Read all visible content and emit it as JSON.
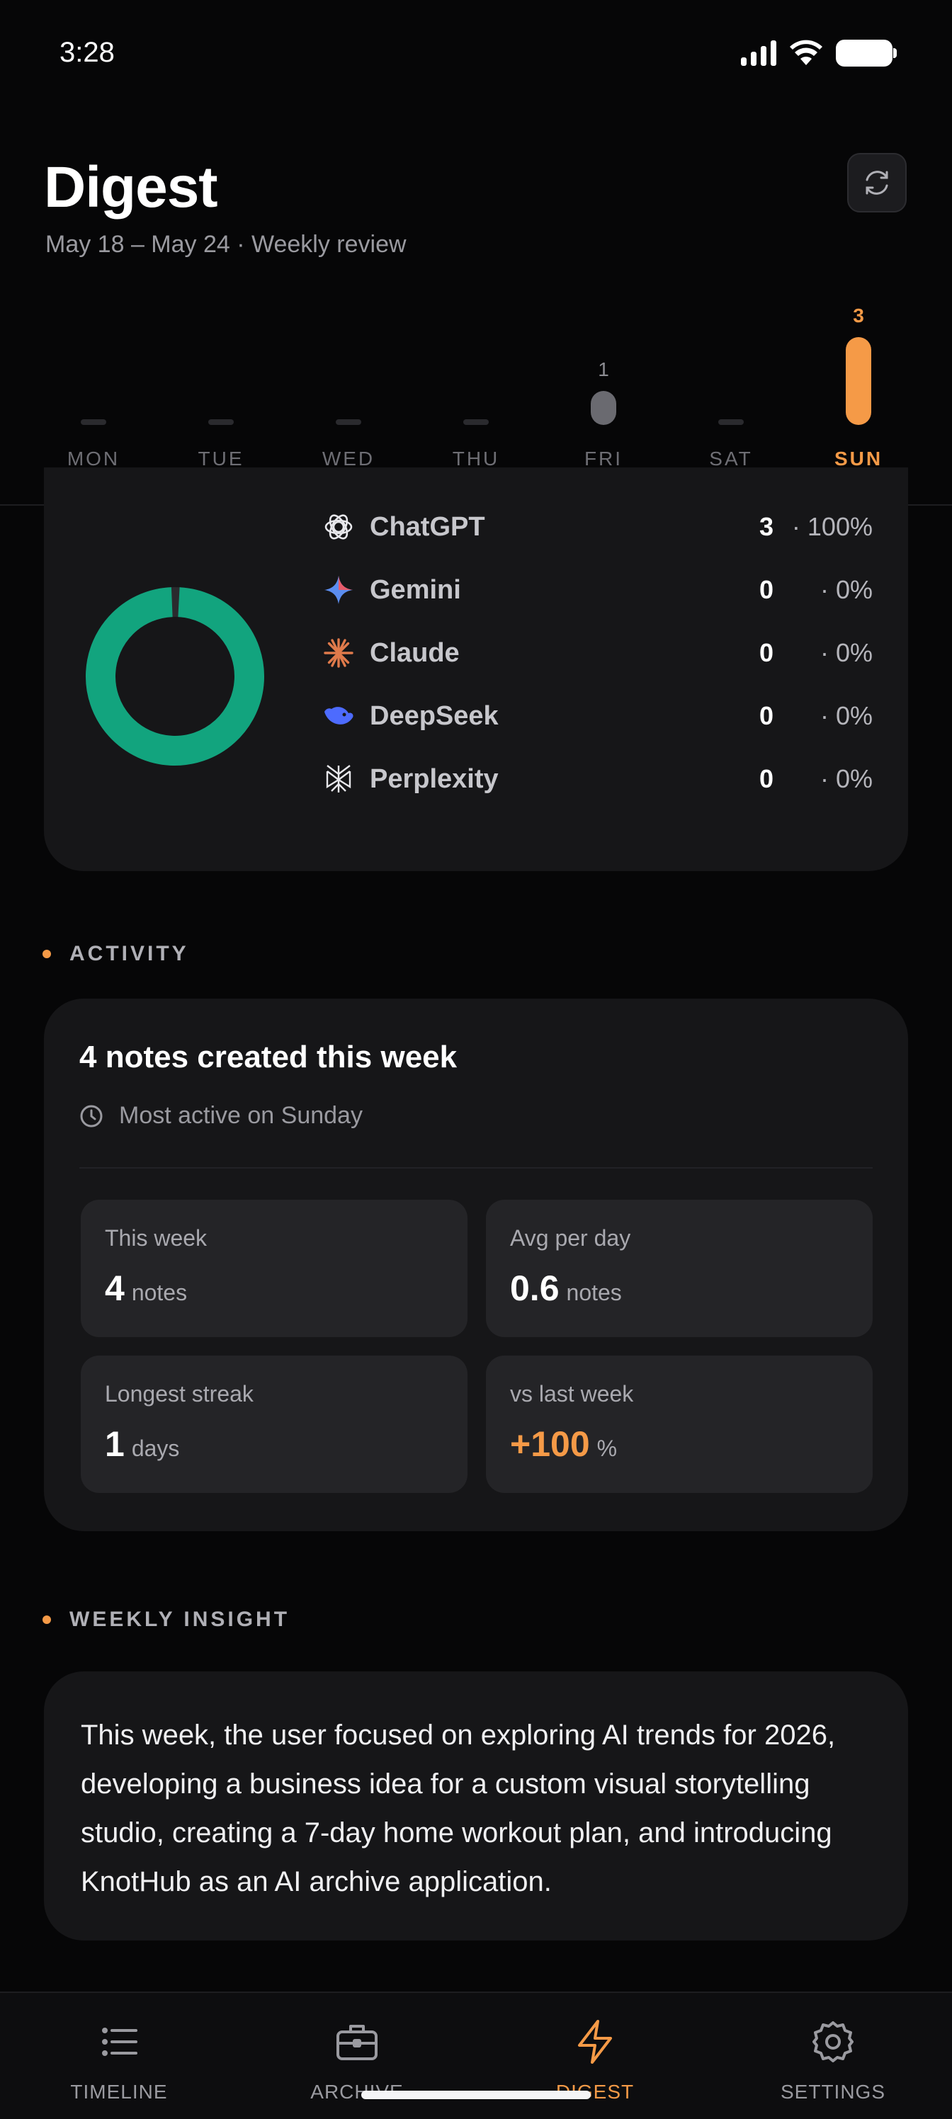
{
  "status_bar": {
    "time": "3:28"
  },
  "header": {
    "title": "Digest",
    "subtitle": "May 18 – May 24 · Weekly review",
    "refresh_icon": "refresh-icon"
  },
  "week_activity": {
    "days": [
      {
        "label": "MON",
        "count": 0,
        "count_label": ""
      },
      {
        "label": "TUE",
        "count": 0,
        "count_label": ""
      },
      {
        "label": "WED",
        "count": 0,
        "count_label": ""
      },
      {
        "label": "THU",
        "count": 0,
        "count_label": ""
      },
      {
        "label": "FRI",
        "count": 1,
        "count_label": "1"
      },
      {
        "label": "SAT",
        "count": 0,
        "count_label": ""
      },
      {
        "label": "SUN",
        "count": 3,
        "count_label": "3"
      }
    ],
    "active_day": "SUN",
    "accent_color": "#f59a47"
  },
  "models": {
    "donut_color": "#12a47e",
    "items": [
      {
        "name": "ChatGPT",
        "count": "3",
        "pct": "· 100%",
        "icon": "chatgpt-icon"
      },
      {
        "name": "Gemini",
        "count": "0",
        "pct": "· 0%",
        "icon": "gemini-icon"
      },
      {
        "name": "Claude",
        "count": "0",
        "pct": "· 0%",
        "icon": "claude-icon"
      },
      {
        "name": "DeepSeek",
        "count": "0",
        "pct": "· 0%",
        "icon": "deepseek-icon"
      },
      {
        "name": "Perplexity",
        "count": "0",
        "pct": "· 0%",
        "icon": "perplexity-icon"
      }
    ],
    "share_fraction": 1.0
  },
  "activity": {
    "section_label": "ACTIVITY",
    "title": "4 notes created this week",
    "most_active": "Most active on Sunday",
    "stats": [
      {
        "label": "This week",
        "value": "4",
        "unit": "notes"
      },
      {
        "label": "Avg per day",
        "value": "0.6",
        "unit": "notes"
      },
      {
        "label": "Longest streak",
        "value": "1",
        "unit": "days"
      },
      {
        "label": "vs last week",
        "value": "+100",
        "unit": "%"
      }
    ]
  },
  "insight": {
    "section_label": "WEEKLY INSIGHT",
    "text": "This week, the user focused on exploring AI trends for 2026, developing a business idea for a custom visual storytelling studio, creating a 7-day home workout plan, and introducing KnotHub as an AI archive application."
  },
  "bottom_nav": {
    "items": [
      {
        "label": "TIMELINE",
        "icon": "timeline-icon"
      },
      {
        "label": "ARCHIVE",
        "icon": "archive-icon"
      },
      {
        "label": "DIGEST",
        "icon": "digest-icon"
      },
      {
        "label": "SETTINGS",
        "icon": "settings-icon"
      }
    ],
    "active": "DIGEST"
  }
}
